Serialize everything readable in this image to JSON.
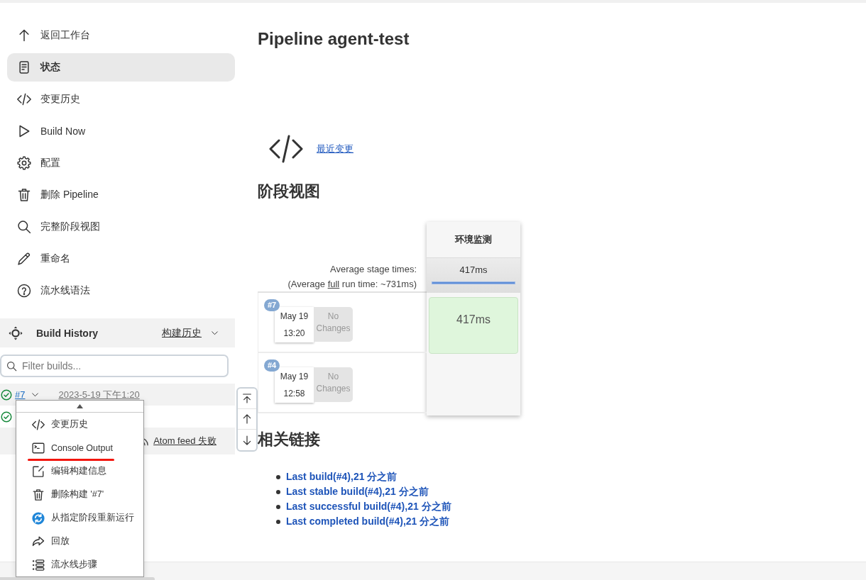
{
  "sidebar": {
    "items": [
      {
        "label": "返回工作台",
        "kind": "up",
        "selected": false
      },
      {
        "label": "状态",
        "kind": "status",
        "selected": true
      },
      {
        "label": "变更历史",
        "kind": "changes",
        "selected": false
      },
      {
        "label": "Build Now",
        "kind": "build",
        "selected": false
      },
      {
        "label": "配置",
        "kind": "configure",
        "selected": false
      },
      {
        "label": "删除 Pipeline",
        "kind": "delete",
        "selected": false
      },
      {
        "label": "完整阶段视图",
        "kind": "search",
        "selected": false
      },
      {
        "label": "重命名",
        "kind": "rename",
        "selected": false
      },
      {
        "label": "流水线语法",
        "kind": "help",
        "selected": false
      }
    ]
  },
  "build_history": {
    "title": "Build History",
    "trend_link": "构建历史",
    "filter": {
      "placeholder": "Filter builds..."
    },
    "builds": [
      {
        "number": "#7",
        "date": "2023-5-19 下午1:20",
        "success": true,
        "selected": true
      },
      {
        "success": true,
        "selected": false
      }
    ],
    "atom_feed": "Atom feed 失败"
  },
  "build_menu": {
    "items": [
      {
        "label": "变更历史",
        "kind": "changes",
        "marked": false
      },
      {
        "label": "Console Output",
        "kind": "console",
        "marked": true
      },
      {
        "label": "编辑构建信息",
        "kind": "edit",
        "marked": false
      },
      {
        "label": "删除构建 '#7'",
        "kind": "delete",
        "marked": false
      },
      {
        "label": "从指定阶段重新运行",
        "kind": "restart",
        "marked": false
      },
      {
        "label": "回放",
        "kind": "replay",
        "marked": false
      },
      {
        "label": "流水线步骤",
        "kind": "steps",
        "marked": false
      }
    ]
  },
  "main": {
    "title": "Pipeline agent-test",
    "recent_changes": {
      "link": "最近变更"
    },
    "stage_view": {
      "heading": "阶段视图",
      "average_label": "Average stage times:",
      "full_run": {
        "before": "(Average ",
        "link": "full",
        "after": " run time: ~731ms)"
      },
      "stages": [
        {
          "name": "环境监测",
          "average": "417ms"
        }
      ],
      "runs": [
        {
          "number": "#7",
          "date": "May 19",
          "time": "13:20",
          "changes": "No Changes",
          "cells": [
            {
              "kind": "success",
              "duration": "417ms"
            }
          ]
        },
        {
          "number": "#4",
          "date": "May 19",
          "time": "12:58",
          "changes": "No Changes",
          "cells": [
            {
              "kind": "empty"
            }
          ]
        }
      ]
    },
    "related_links": {
      "heading": "相关链接",
      "links": [
        "Last build(#4),21 分之前",
        "Last stable build(#4),21 分之前",
        "Last successful build(#4),21 分之前",
        "Last completed build(#4),21 分之前"
      ]
    }
  }
}
